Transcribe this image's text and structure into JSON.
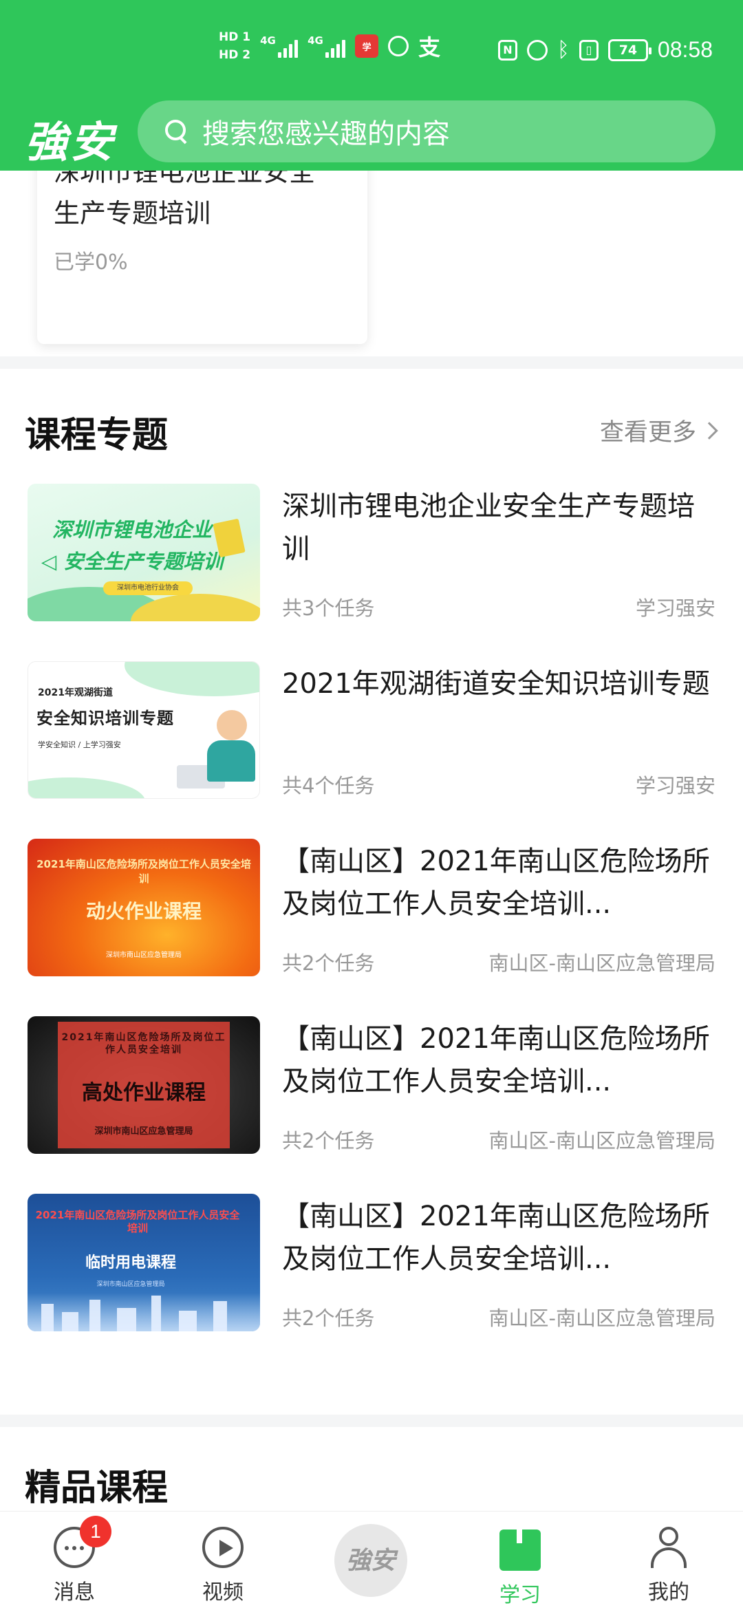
{
  "status_bar": {
    "hd1": "HD 1",
    "hd2": "HD 2",
    "net1": "4G",
    "net2": "4G",
    "battery": "74",
    "time": "08:58"
  },
  "header": {
    "brand": "強安",
    "search_placeholder": "搜索您感兴趣的内容"
  },
  "prev_card": {
    "title_line1": "深圳市锂电池企业安全",
    "title_line2": "生产专题培训",
    "progress": "已学0%"
  },
  "topics": {
    "title": "课程专题",
    "more": "查看更多",
    "items": [
      {
        "title": "深圳市锂电池企业安全生产专题培训",
        "tasks": "共3个任务",
        "source": "学习强安",
        "thumb": {
          "line1": "深圳市锂电池企业",
          "line2": "◁ 安全生产专题培训",
          "tag": "深圳市电池行业协会"
        }
      },
      {
        "title": "2021年观湖街道安全知识培训专题",
        "tasks": "共4个任务",
        "source": "学习强安",
        "thumb": {
          "line1": "2021年观湖街道",
          "line2": "安全知识培训专题",
          "line3": "学安全知识 / 上学习强安"
        }
      },
      {
        "title": "【南山区】2021年南山区危险场所及岗位工作人员安全培训...",
        "tasks": "共2个任务",
        "source": "南山区-南山区应急管理局",
        "thumb": {
          "line1": "2021年南山区危险场所及岗位工作人员安全培训",
          "line2": "动火作业课程",
          "line3": "深圳市南山区应急管理局"
        }
      },
      {
        "title": "【南山区】2021年南山区危险场所及岗位工作人员安全培训...",
        "tasks": "共2个任务",
        "source": "南山区-南山区应急管理局",
        "thumb": {
          "line1": "2021年南山区危险场所及岗位工作人员安全培训",
          "line2": "高处作业课程",
          "line3": "深圳市南山区应急管理局"
        }
      },
      {
        "title": "【南山区】2021年南山区危险场所及岗位工作人员安全培训...",
        "tasks": "共2个任务",
        "source": "南山区-南山区应急管理局",
        "thumb": {
          "line1": "2021年南山区危险场所及岗位工作人员安全培训",
          "line2": "临时用电课程",
          "line3": "深圳市南山区应急管理局"
        }
      }
    ]
  },
  "premium": {
    "title": "精品课程"
  },
  "tabbar": {
    "messages": "消息",
    "messages_badge": "1",
    "video": "视频",
    "center": "強安",
    "study": "学习",
    "mine": "我的",
    "active": "study"
  },
  "colors": {
    "brand_green": "#2fc65a",
    "badge_red": "#f0322d"
  }
}
